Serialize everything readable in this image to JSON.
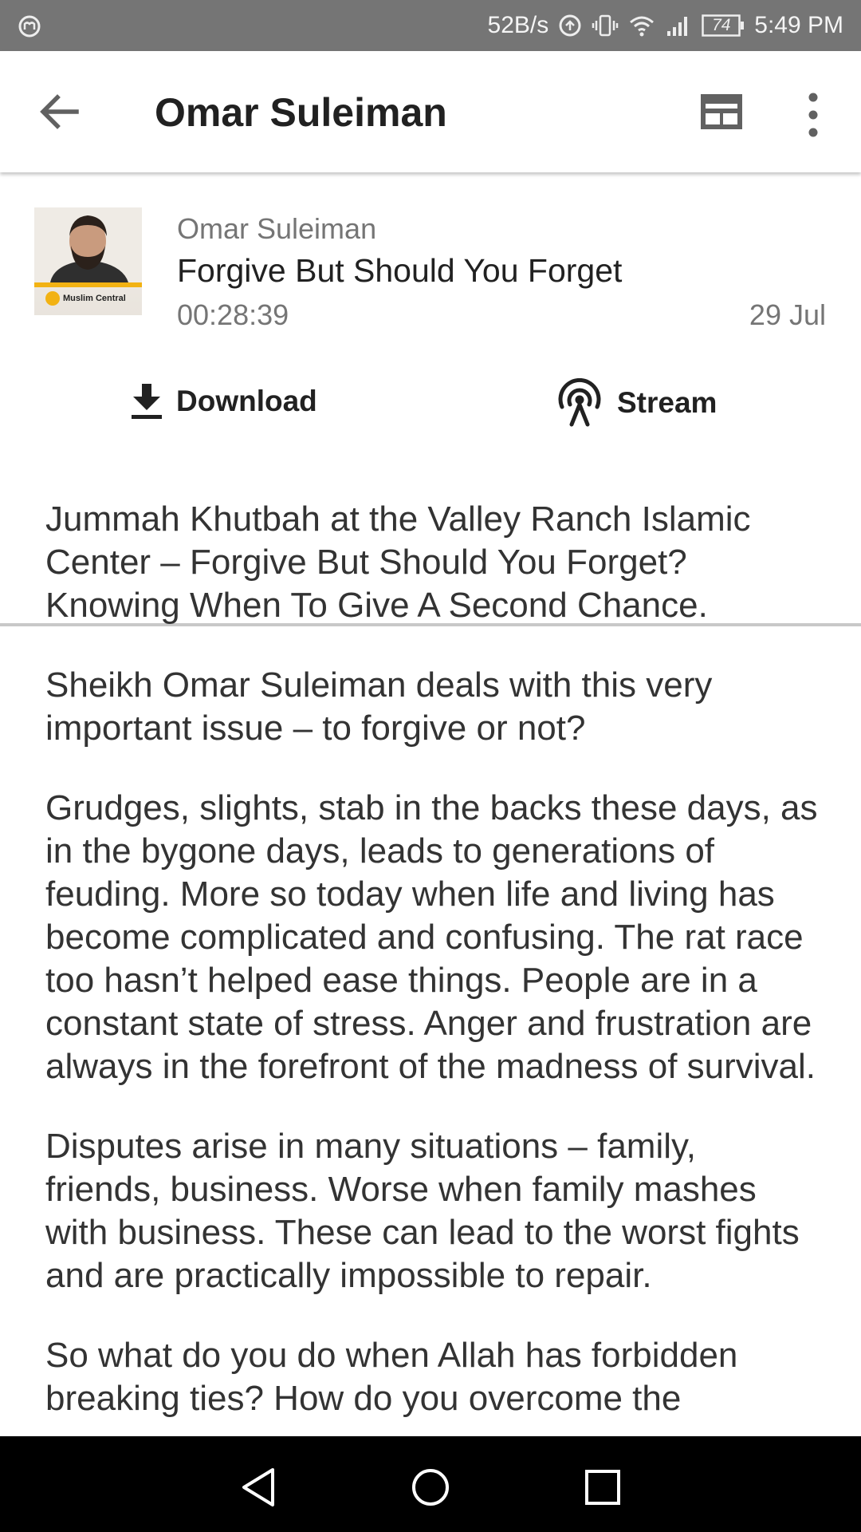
{
  "status_bar": {
    "network_speed": "52B/s",
    "battery": "74",
    "time": "5:49 PM"
  },
  "app_bar": {
    "title": "Omar Suleiman"
  },
  "episode": {
    "author": "Omar Suleiman",
    "title": "Forgive But Should You Forget",
    "duration": "00:28:39",
    "date": "29 Jul",
    "thumbnail_brand": "Muslim Central"
  },
  "actions": {
    "download_label": "Download",
    "stream_label": "Stream"
  },
  "description": {
    "paragraphs": [
      "Jummah Khutbah at the Valley Ranch Islamic Center – Forgive But Should You Forget? Knowing When To Give A Second Chance.",
      "Sheikh Omar Suleiman deals with this very important issue – to forgive or not?",
      "Grudges, slights, stab in the backs these days, as in the bygone days, leads to generations of feuding. More so today when life and living has become complicated and confusing. The rat race too hasn’t helped ease things. People are in a constant state of stress. Anger and frustration are always in the forefront of  the madness of survival.",
      "Disputes arise in many situations – family, friends, business. Worse when family mashes with business. These can lead to the worst fights and are practically impossible to repair.",
      "So what do you do when Allah has forbidden breaking ties? How do you overcome the"
    ]
  },
  "icons": {
    "back": "back-arrow-icon",
    "layout": "layout-toggle-icon",
    "more": "more-vert-icon",
    "download": "download-icon",
    "stream": "podcast-stream-icon",
    "nav_back": "nav-back-icon",
    "nav_home": "nav-home-icon",
    "nav_recents": "nav-recents-icon"
  },
  "colors": {
    "status_bar": "#757575",
    "text_primary": "#212121",
    "text_secondary": "#757575",
    "divider": "#c8c8c8",
    "nav_bar": "#000000",
    "brand_accent": "#f2b213"
  }
}
